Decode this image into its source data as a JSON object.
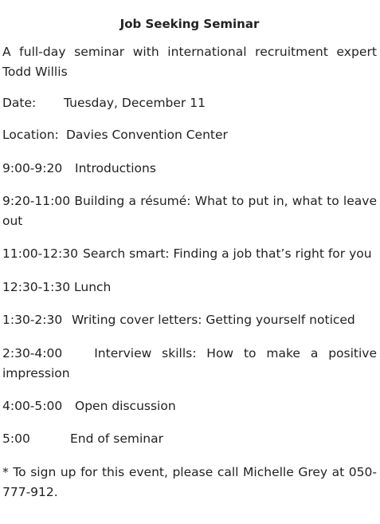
{
  "seminar": {
    "title": "Job Seeking Seminar",
    "description": "A full-day seminar with international recruitment expert Todd Willis",
    "date_label": "Date:",
    "date_value": "Tuesday, December 11",
    "location_label": "Location:",
    "location_value": "Davies Convention Center",
    "schedule": [
      {
        "time": "9:00-9:20",
        "activity": "Introductions"
      },
      {
        "time": "9:20-11:00",
        "activity": "Building a résumé: What to put in, what to leave out"
      },
      {
        "time": "11:00-12:30",
        "activity": "Search smart: Finding a job that’s right for you"
      },
      {
        "time": "12:30-1:30",
        "activity": "Lunch"
      },
      {
        "time": "1:30-2:30",
        "activity": "Writing cover letters: Getting yourself noticed"
      },
      {
        "time": "2:30-4:00",
        "activity": "Interview skills: How to make a positive impression"
      },
      {
        "time": "4:00-5:00",
        "activity": "Open discussion"
      },
      {
        "time": "5:00",
        "activity": "End of seminar"
      }
    ],
    "footnote": "* To sign up for this event, please call Michelle Grey at 050-777-912."
  }
}
